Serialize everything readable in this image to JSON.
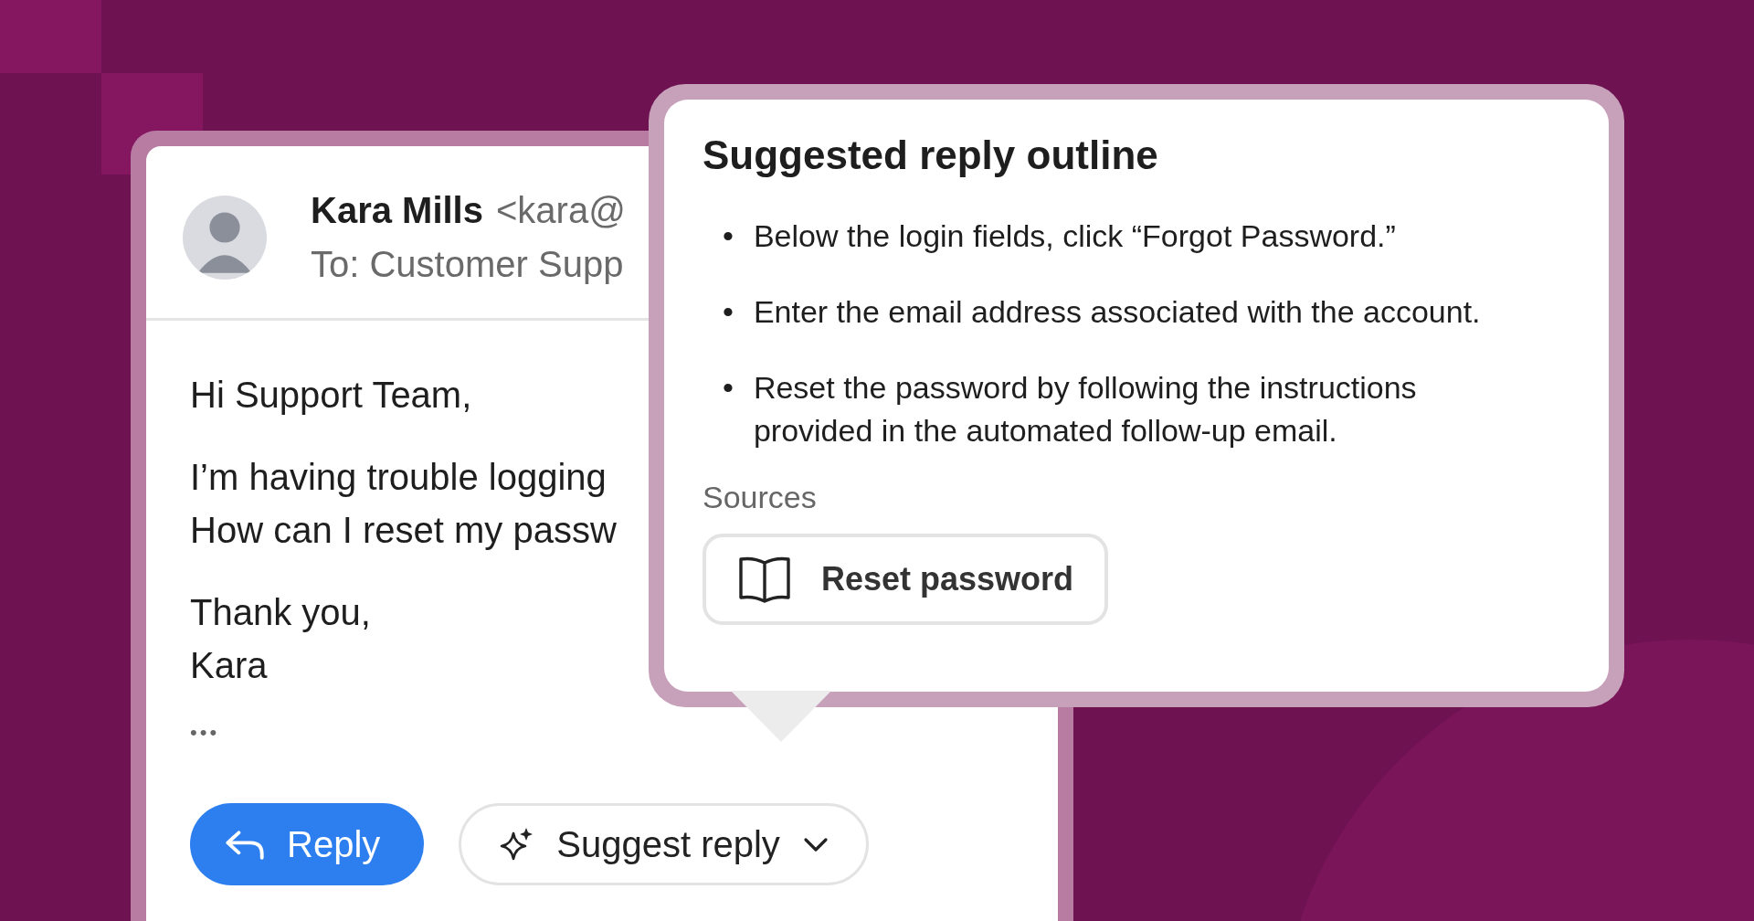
{
  "email": {
    "sender_name": "Kara Mills",
    "sender_address": "<kara@",
    "to": "To: Customer Supp",
    "paragraphs": [
      [
        "Hi Support Team,"
      ],
      [
        "I’m having trouble logging",
        "How can I reset my passw"
      ],
      [
        "Thank you,",
        "Kara"
      ]
    ],
    "more": "•••",
    "reply_button": "Reply",
    "suggest_button": "Suggest reply"
  },
  "popup": {
    "title": "Suggested reply outline",
    "bullets": [
      {
        "marker": "•",
        "text": "Below the login fields, click “Forgot Password.”"
      },
      {
        "marker": "•",
        "text": "Enter the email address associated with the account."
      },
      {
        "marker": "•",
        "text": "Reset the password by following the instructions provided in the automated follow-up email."
      }
    ],
    "sources_label": "Sources",
    "sources": [
      {
        "label": "Reset password"
      }
    ]
  }
}
